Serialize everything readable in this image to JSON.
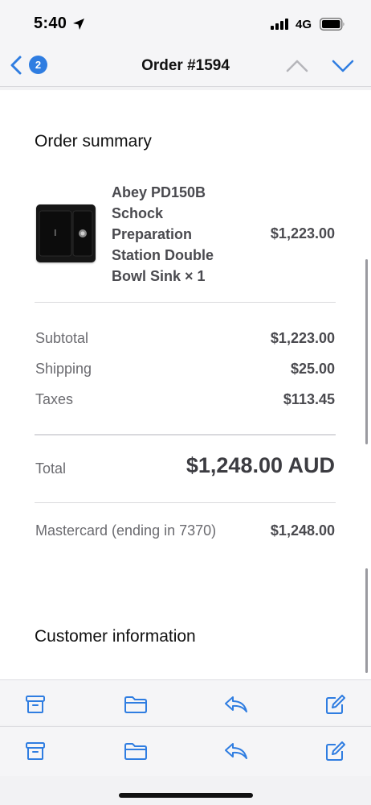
{
  "status": {
    "time": "5:40",
    "network": "4G",
    "icons": [
      "location-arrow-icon",
      "signal-icon",
      "battery-icon"
    ]
  },
  "nav": {
    "badge_count": "2",
    "title": "Order #1594",
    "icons": [
      "chevron-left-icon",
      "chevron-up-icon",
      "chevron-down-icon"
    ]
  },
  "order": {
    "section_title": "Order summary",
    "product": {
      "name": "Abey PD150B Schock Preparation Station Double Bowl Sink × 1",
      "price": "$1,223.00"
    },
    "summary": [
      {
        "label": "Subtotal",
        "value": "$1,223.00"
      },
      {
        "label": "Shipping",
        "value": "$25.00"
      },
      {
        "label": "Taxes",
        "value": "$113.45"
      }
    ],
    "total": {
      "label": "Total",
      "value": "$1,248.00 AUD"
    },
    "payment": {
      "label": "Mastercard (ending in 7370)",
      "value": "$1,248.00"
    }
  },
  "customer": {
    "section_title": "Customer information"
  },
  "toolbar": {
    "icons": [
      "archive-icon",
      "folder-icon",
      "reply-icon",
      "compose-icon"
    ]
  },
  "colors": {
    "accent": "#2f7de1",
    "background": "#f2f2f4",
    "card": "#ffffff"
  }
}
